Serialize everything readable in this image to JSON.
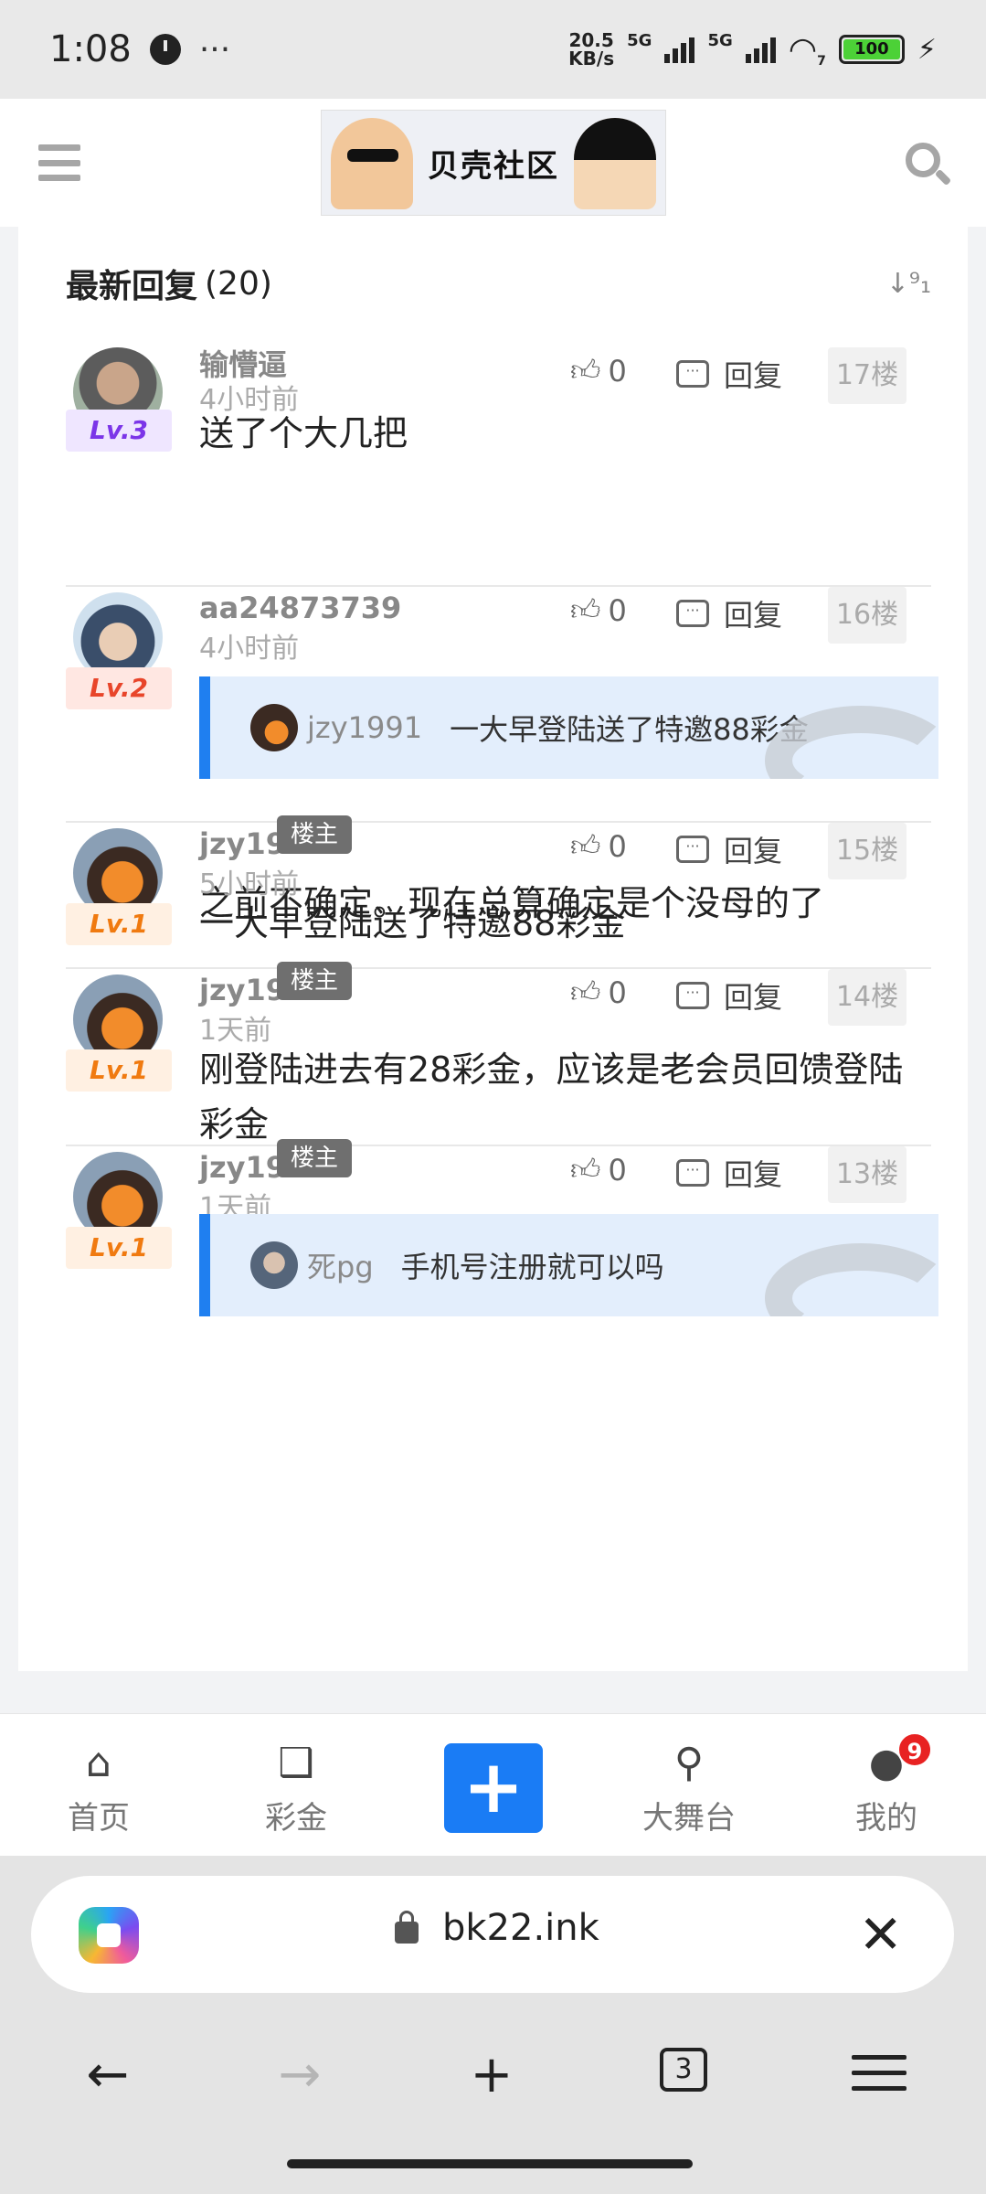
{
  "status_bar": {
    "time": "1:08",
    "more": "···",
    "net_speed": "20.5",
    "net_unit": "KB/s",
    "sig1_label": "5G",
    "sig2_label": "5G",
    "wifi_label": "7",
    "battery": "100"
  },
  "header": {
    "logo_text": "贝壳社区"
  },
  "section": {
    "title": "最新回复",
    "count": "(20)",
    "sort_icon_text": "↓⁹₁"
  },
  "posts": [
    {
      "user": "输懵逼",
      "time": "4小时前",
      "level": "Lv.3",
      "likes": "0",
      "reply_label": "回复",
      "floor": "17楼",
      "content": "送了个大几把"
    },
    {
      "user": "aa24873739",
      "time": "4小时前",
      "level": "Lv.2",
      "likes": "0",
      "reply_label": "回复",
      "floor": "16楼",
      "quote_user": "jzy1991",
      "quote_text": "一大早登陆送了特邀88彩金",
      "content": "之前不确定。现在总算确定是个没母的了"
    },
    {
      "user": "jzy19",
      "badge": "楼主",
      "time": "5小时前",
      "level": "Lv.1",
      "likes": "0",
      "reply_label": "回复",
      "floor": "15楼",
      "content": "一大早登陆送了特邀88彩金"
    },
    {
      "user": "jzy19",
      "badge": "楼主",
      "time": "1天前",
      "level": "Lv.1",
      "likes": "0",
      "reply_label": "回复",
      "floor": "14楼",
      "content": "刚登陆进去有28彩金，应该是老会员回馈登陆彩金"
    },
    {
      "user": "jzy19",
      "badge": "楼主",
      "time": "1天前",
      "level": "Lv.1",
      "likes": "0",
      "reply_label": "回复",
      "floor": "13楼",
      "quote_user": "死pg",
      "quote_text": "手机号注册就可以吗"
    }
  ],
  "bottom_nav": {
    "home": "首页",
    "bonus": "彩金",
    "add": "+",
    "stage": "大舞台",
    "mine": "我的",
    "notif_count": "9"
  },
  "browser": {
    "url": "bk22.ink",
    "tab_count": "3"
  },
  "colors": {
    "accent": "#1a7cf5",
    "lv3": "#7b35e8",
    "lv2": "#e8452a",
    "lv1": "#f07a10"
  }
}
